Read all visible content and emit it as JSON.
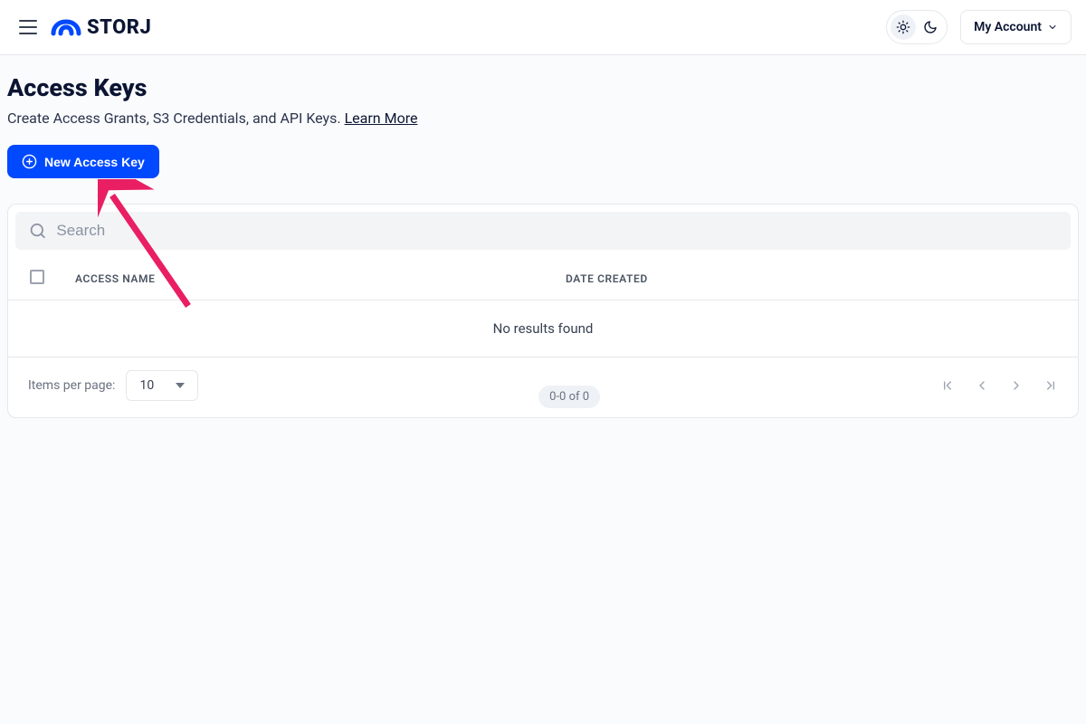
{
  "header": {
    "brand": "STORJ",
    "account_label": "My Account"
  },
  "page": {
    "title": "Access Keys",
    "subtitle_prefix": "Create Access Grants, S3 Credentials, and API Keys. ",
    "learn_more": "Learn More",
    "new_key_label": "New Access Key"
  },
  "search": {
    "placeholder": "Search"
  },
  "table": {
    "col_access_name": "ACCESS NAME",
    "col_date_created": "DATE CREATED",
    "empty_text": "No results found"
  },
  "pagination": {
    "items_per_page_label": "Items per page:",
    "per_page_value": "10",
    "range_text": "0-0 of 0"
  }
}
